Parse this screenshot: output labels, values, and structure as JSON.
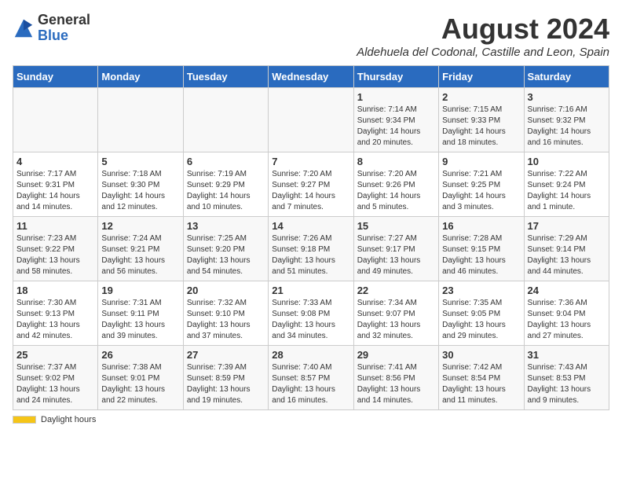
{
  "logo": {
    "text_general": "General",
    "text_blue": "Blue"
  },
  "title": "August 2024",
  "subtitle": "Aldehuela del Codonal, Castille and Leon, Spain",
  "days": [
    "Sunday",
    "Monday",
    "Tuesday",
    "Wednesday",
    "Thursday",
    "Friday",
    "Saturday"
  ],
  "weeks": [
    [
      {
        "date": "",
        "sunrise": "",
        "sunset": "",
        "daylight": ""
      },
      {
        "date": "",
        "sunrise": "",
        "sunset": "",
        "daylight": ""
      },
      {
        "date": "",
        "sunrise": "",
        "sunset": "",
        "daylight": ""
      },
      {
        "date": "",
        "sunrise": "",
        "sunset": "",
        "daylight": ""
      },
      {
        "date": "1",
        "sunrise": "Sunrise: 7:14 AM",
        "sunset": "Sunset: 9:34 PM",
        "daylight": "Daylight: 14 hours and 20 minutes."
      },
      {
        "date": "2",
        "sunrise": "Sunrise: 7:15 AM",
        "sunset": "Sunset: 9:33 PM",
        "daylight": "Daylight: 14 hours and 18 minutes."
      },
      {
        "date": "3",
        "sunrise": "Sunrise: 7:16 AM",
        "sunset": "Sunset: 9:32 PM",
        "daylight": "Daylight: 14 hours and 16 minutes."
      }
    ],
    [
      {
        "date": "4",
        "sunrise": "Sunrise: 7:17 AM",
        "sunset": "Sunset: 9:31 PM",
        "daylight": "Daylight: 14 hours and 14 minutes."
      },
      {
        "date": "5",
        "sunrise": "Sunrise: 7:18 AM",
        "sunset": "Sunset: 9:30 PM",
        "daylight": "Daylight: 14 hours and 12 minutes."
      },
      {
        "date": "6",
        "sunrise": "Sunrise: 7:19 AM",
        "sunset": "Sunset: 9:29 PM",
        "daylight": "Daylight: 14 hours and 10 minutes."
      },
      {
        "date": "7",
        "sunrise": "Sunrise: 7:20 AM",
        "sunset": "Sunset: 9:27 PM",
        "daylight": "Daylight: 14 hours and 7 minutes."
      },
      {
        "date": "8",
        "sunrise": "Sunrise: 7:20 AM",
        "sunset": "Sunset: 9:26 PM",
        "daylight": "Daylight: 14 hours and 5 minutes."
      },
      {
        "date": "9",
        "sunrise": "Sunrise: 7:21 AM",
        "sunset": "Sunset: 9:25 PM",
        "daylight": "Daylight: 14 hours and 3 minutes."
      },
      {
        "date": "10",
        "sunrise": "Sunrise: 7:22 AM",
        "sunset": "Sunset: 9:24 PM",
        "daylight": "Daylight: 14 hours and 1 minute."
      }
    ],
    [
      {
        "date": "11",
        "sunrise": "Sunrise: 7:23 AM",
        "sunset": "Sunset: 9:22 PM",
        "daylight": "Daylight: 13 hours and 58 minutes."
      },
      {
        "date": "12",
        "sunrise": "Sunrise: 7:24 AM",
        "sunset": "Sunset: 9:21 PM",
        "daylight": "Daylight: 13 hours and 56 minutes."
      },
      {
        "date": "13",
        "sunrise": "Sunrise: 7:25 AM",
        "sunset": "Sunset: 9:20 PM",
        "daylight": "Daylight: 13 hours and 54 minutes."
      },
      {
        "date": "14",
        "sunrise": "Sunrise: 7:26 AM",
        "sunset": "Sunset: 9:18 PM",
        "daylight": "Daylight: 13 hours and 51 minutes."
      },
      {
        "date": "15",
        "sunrise": "Sunrise: 7:27 AM",
        "sunset": "Sunset: 9:17 PM",
        "daylight": "Daylight: 13 hours and 49 minutes."
      },
      {
        "date": "16",
        "sunrise": "Sunrise: 7:28 AM",
        "sunset": "Sunset: 9:15 PM",
        "daylight": "Daylight: 13 hours and 46 minutes."
      },
      {
        "date": "17",
        "sunrise": "Sunrise: 7:29 AM",
        "sunset": "Sunset: 9:14 PM",
        "daylight": "Daylight: 13 hours and 44 minutes."
      }
    ],
    [
      {
        "date": "18",
        "sunrise": "Sunrise: 7:30 AM",
        "sunset": "Sunset: 9:13 PM",
        "daylight": "Daylight: 13 hours and 42 minutes."
      },
      {
        "date": "19",
        "sunrise": "Sunrise: 7:31 AM",
        "sunset": "Sunset: 9:11 PM",
        "daylight": "Daylight: 13 hours and 39 minutes."
      },
      {
        "date": "20",
        "sunrise": "Sunrise: 7:32 AM",
        "sunset": "Sunset: 9:10 PM",
        "daylight": "Daylight: 13 hours and 37 minutes."
      },
      {
        "date": "21",
        "sunrise": "Sunrise: 7:33 AM",
        "sunset": "Sunset: 9:08 PM",
        "daylight": "Daylight: 13 hours and 34 minutes."
      },
      {
        "date": "22",
        "sunrise": "Sunrise: 7:34 AM",
        "sunset": "Sunset: 9:07 PM",
        "daylight": "Daylight: 13 hours and 32 minutes."
      },
      {
        "date": "23",
        "sunrise": "Sunrise: 7:35 AM",
        "sunset": "Sunset: 9:05 PM",
        "daylight": "Daylight: 13 hours and 29 minutes."
      },
      {
        "date": "24",
        "sunrise": "Sunrise: 7:36 AM",
        "sunset": "Sunset: 9:04 PM",
        "daylight": "Daylight: 13 hours and 27 minutes."
      }
    ],
    [
      {
        "date": "25",
        "sunrise": "Sunrise: 7:37 AM",
        "sunset": "Sunset: 9:02 PM",
        "daylight": "Daylight: 13 hours and 24 minutes."
      },
      {
        "date": "26",
        "sunrise": "Sunrise: 7:38 AM",
        "sunset": "Sunset: 9:01 PM",
        "daylight": "Daylight: 13 hours and 22 minutes."
      },
      {
        "date": "27",
        "sunrise": "Sunrise: 7:39 AM",
        "sunset": "Sunset: 8:59 PM",
        "daylight": "Daylight: 13 hours and 19 minutes."
      },
      {
        "date": "28",
        "sunrise": "Sunrise: 7:40 AM",
        "sunset": "Sunset: 8:57 PM",
        "daylight": "Daylight: 13 hours and 16 minutes."
      },
      {
        "date": "29",
        "sunrise": "Sunrise: 7:41 AM",
        "sunset": "Sunset: 8:56 PM",
        "daylight": "Daylight: 13 hours and 14 minutes."
      },
      {
        "date": "30",
        "sunrise": "Sunrise: 7:42 AM",
        "sunset": "Sunset: 8:54 PM",
        "daylight": "Daylight: 13 hours and 11 minutes."
      },
      {
        "date": "31",
        "sunrise": "Sunrise: 7:43 AM",
        "sunset": "Sunset: 8:53 PM",
        "daylight": "Daylight: 13 hours and 9 minutes."
      }
    ]
  ],
  "footer": {
    "daylight_label": "Daylight hours"
  }
}
